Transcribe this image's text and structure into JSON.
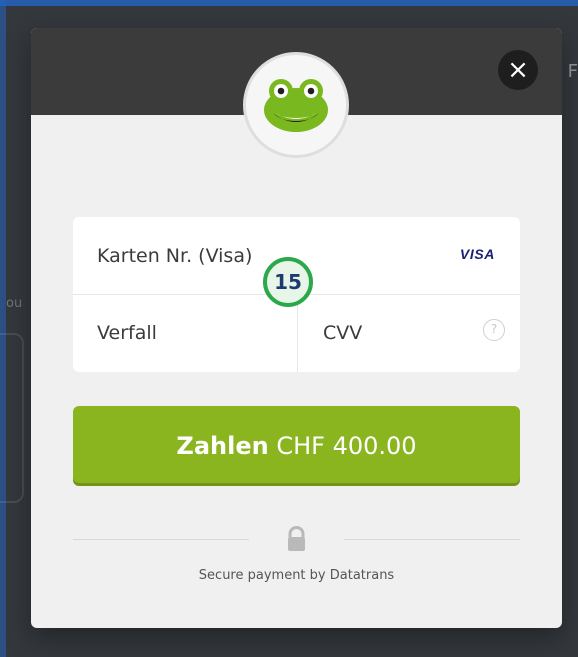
{
  "background": {
    "partial_text": "n F",
    "side_text": "ou"
  },
  "modal": {
    "close_label": "×",
    "logo_icon": "frog-logo-icon",
    "form": {
      "card_number_label": "Karten Nr. (Visa)",
      "card_brand": "VISA",
      "expiry_label": "Verfall",
      "cvv_label": "CVV",
      "cvv_help_label": "?"
    },
    "step_badge": "15",
    "pay_button": {
      "label_strong": "Zahlen",
      "label_amount": "CHF 400.00"
    },
    "secure": {
      "lock_icon": "lock-icon",
      "text": "Secure payment by Datatrans"
    }
  },
  "colors": {
    "brand_green": "#8ab51f",
    "visa_blue": "#1a1f71",
    "modal_header": "#3b3b3b",
    "modal_bg": "#f0f0f1"
  }
}
